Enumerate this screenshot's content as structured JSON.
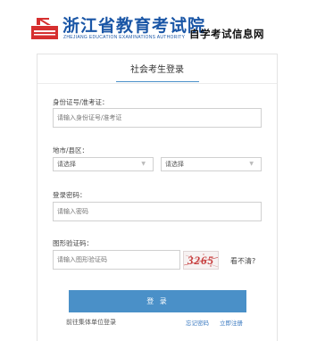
{
  "header": {
    "logo_main": "浙江省教育考试院",
    "logo_sub": "ZHEJIANG EDUCATION EXAMINATIONS AUTHORITY",
    "logo_tail": "自学考试信息网"
  },
  "login": {
    "tab_title": "社会考生登录",
    "id_label": "身份证号/准考证：",
    "id_placeholder": "请输入身份证号/准考证",
    "region_label": "地市/县区：",
    "city_value": "请选择",
    "district_value": "请选择",
    "password_label": "登录密码：",
    "password_placeholder": "请输入密码",
    "captcha_label": "图形验证码：",
    "captcha_placeholder": "请输入图形验证码",
    "captcha_text": "3265",
    "captcha_refresh": "看不清?",
    "login_button": "登 录",
    "group_login_link": "前往集体单位登录",
    "forgot_link": "忘记密码",
    "register_link": "立即注册"
  },
  "colors": {
    "brand_blue": "#1a56a6",
    "accent": "#4a90c8",
    "logo_red": "#d62f2f"
  }
}
